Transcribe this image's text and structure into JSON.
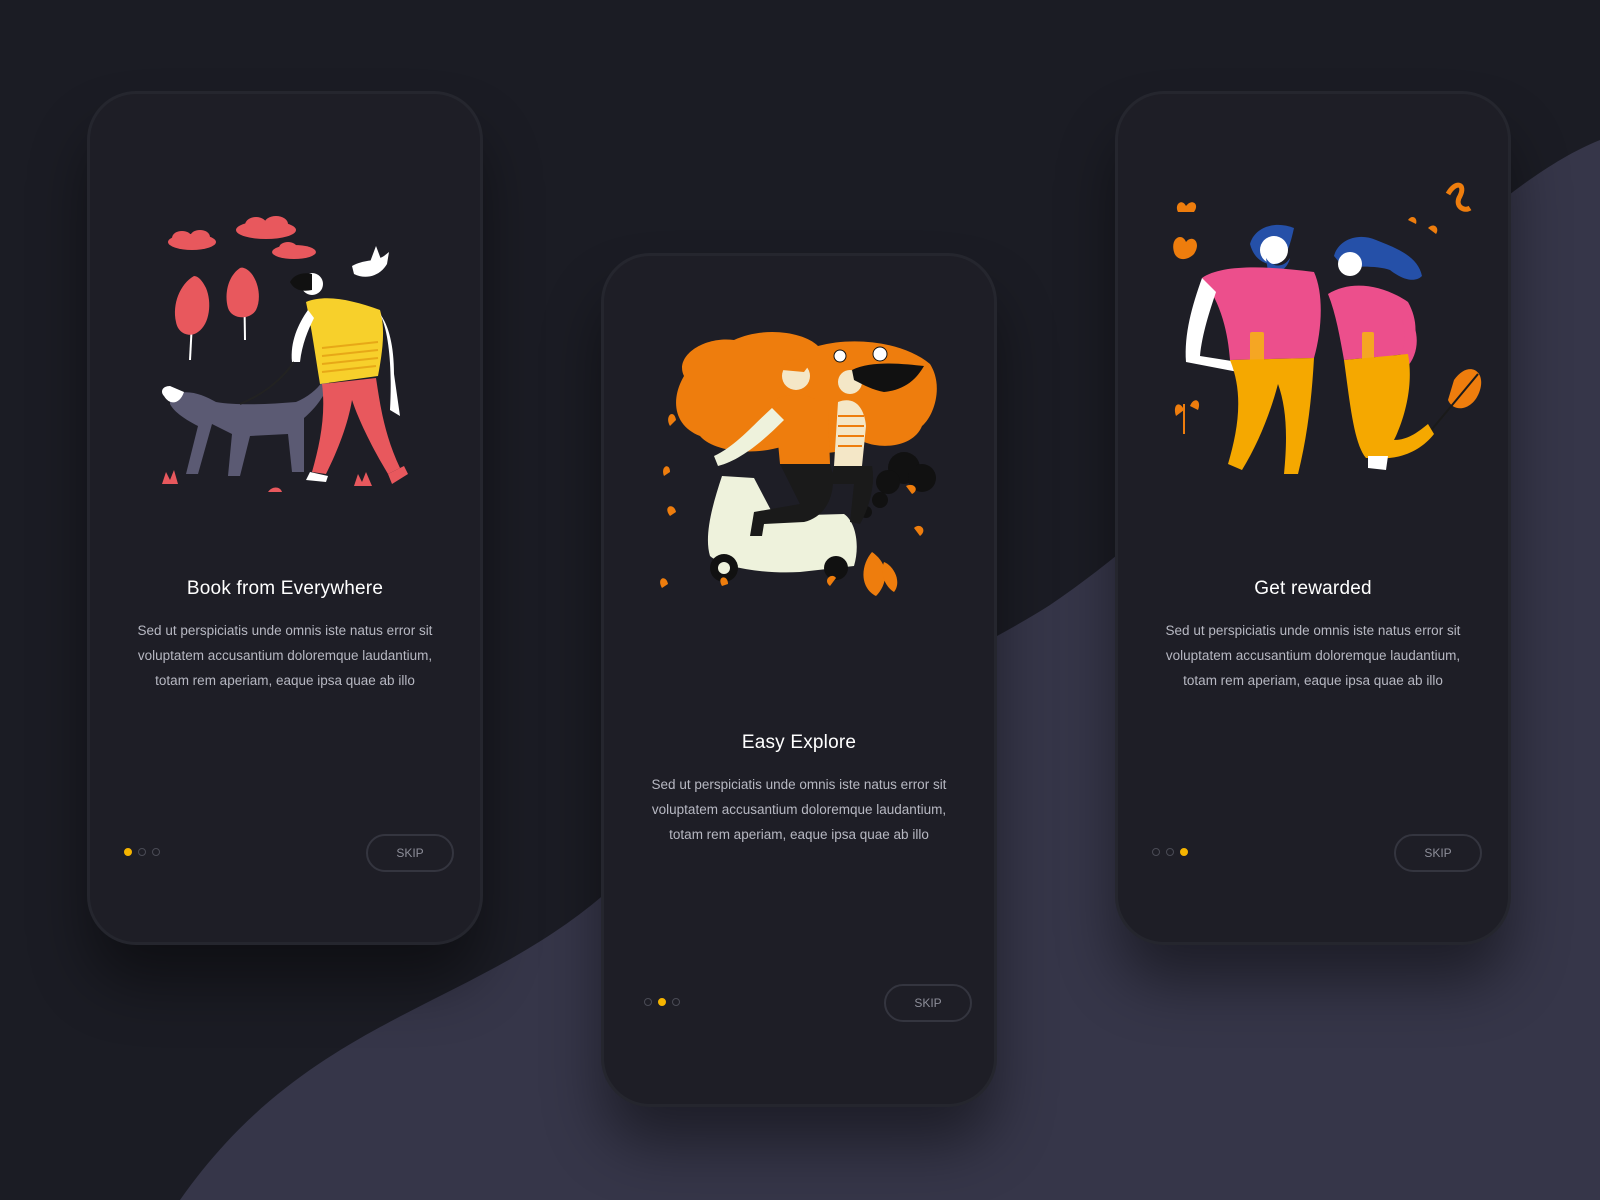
{
  "colors": {
    "background": "#1b1c24",
    "wave": "#363649",
    "phone": "#1e1e26",
    "accent_dot": "#f5b400",
    "title": "#ffffff",
    "body_text": "#b7b8c2",
    "skip_text": "#8d8e99"
  },
  "screens": [
    {
      "title": "Book from Everywhere",
      "illustration": "man-walking-dog-illustration",
      "description": "Sed ut perspiciatis unde omnis iste natus error sit voluptatem accusantium  doloremque laudantium, totam rem aperiam, eaque ipsa quae ab illo",
      "active_page": 1,
      "skip_label": "SKIP"
    },
    {
      "title": "Easy Explore",
      "illustration": "couple-on-scooter-illustration",
      "description": "Sed ut perspiciatis unde omnis iste natus error sit voluptatem accusantium  doloremque laudantium, totam rem aperiam, eaque ipsa quae ab illo",
      "active_page": 2,
      "skip_label": "SKIP"
    },
    {
      "title": "Get rewarded",
      "illustration": "dancing-couple-illustration",
      "description": "Sed ut perspiciatis unde omnis iste natus error sit voluptatem accusantium  doloremque laudantium, totam rem aperiam, eaque ipsa quae ab illo",
      "active_page": 3,
      "skip_label": "SKIP"
    }
  ]
}
